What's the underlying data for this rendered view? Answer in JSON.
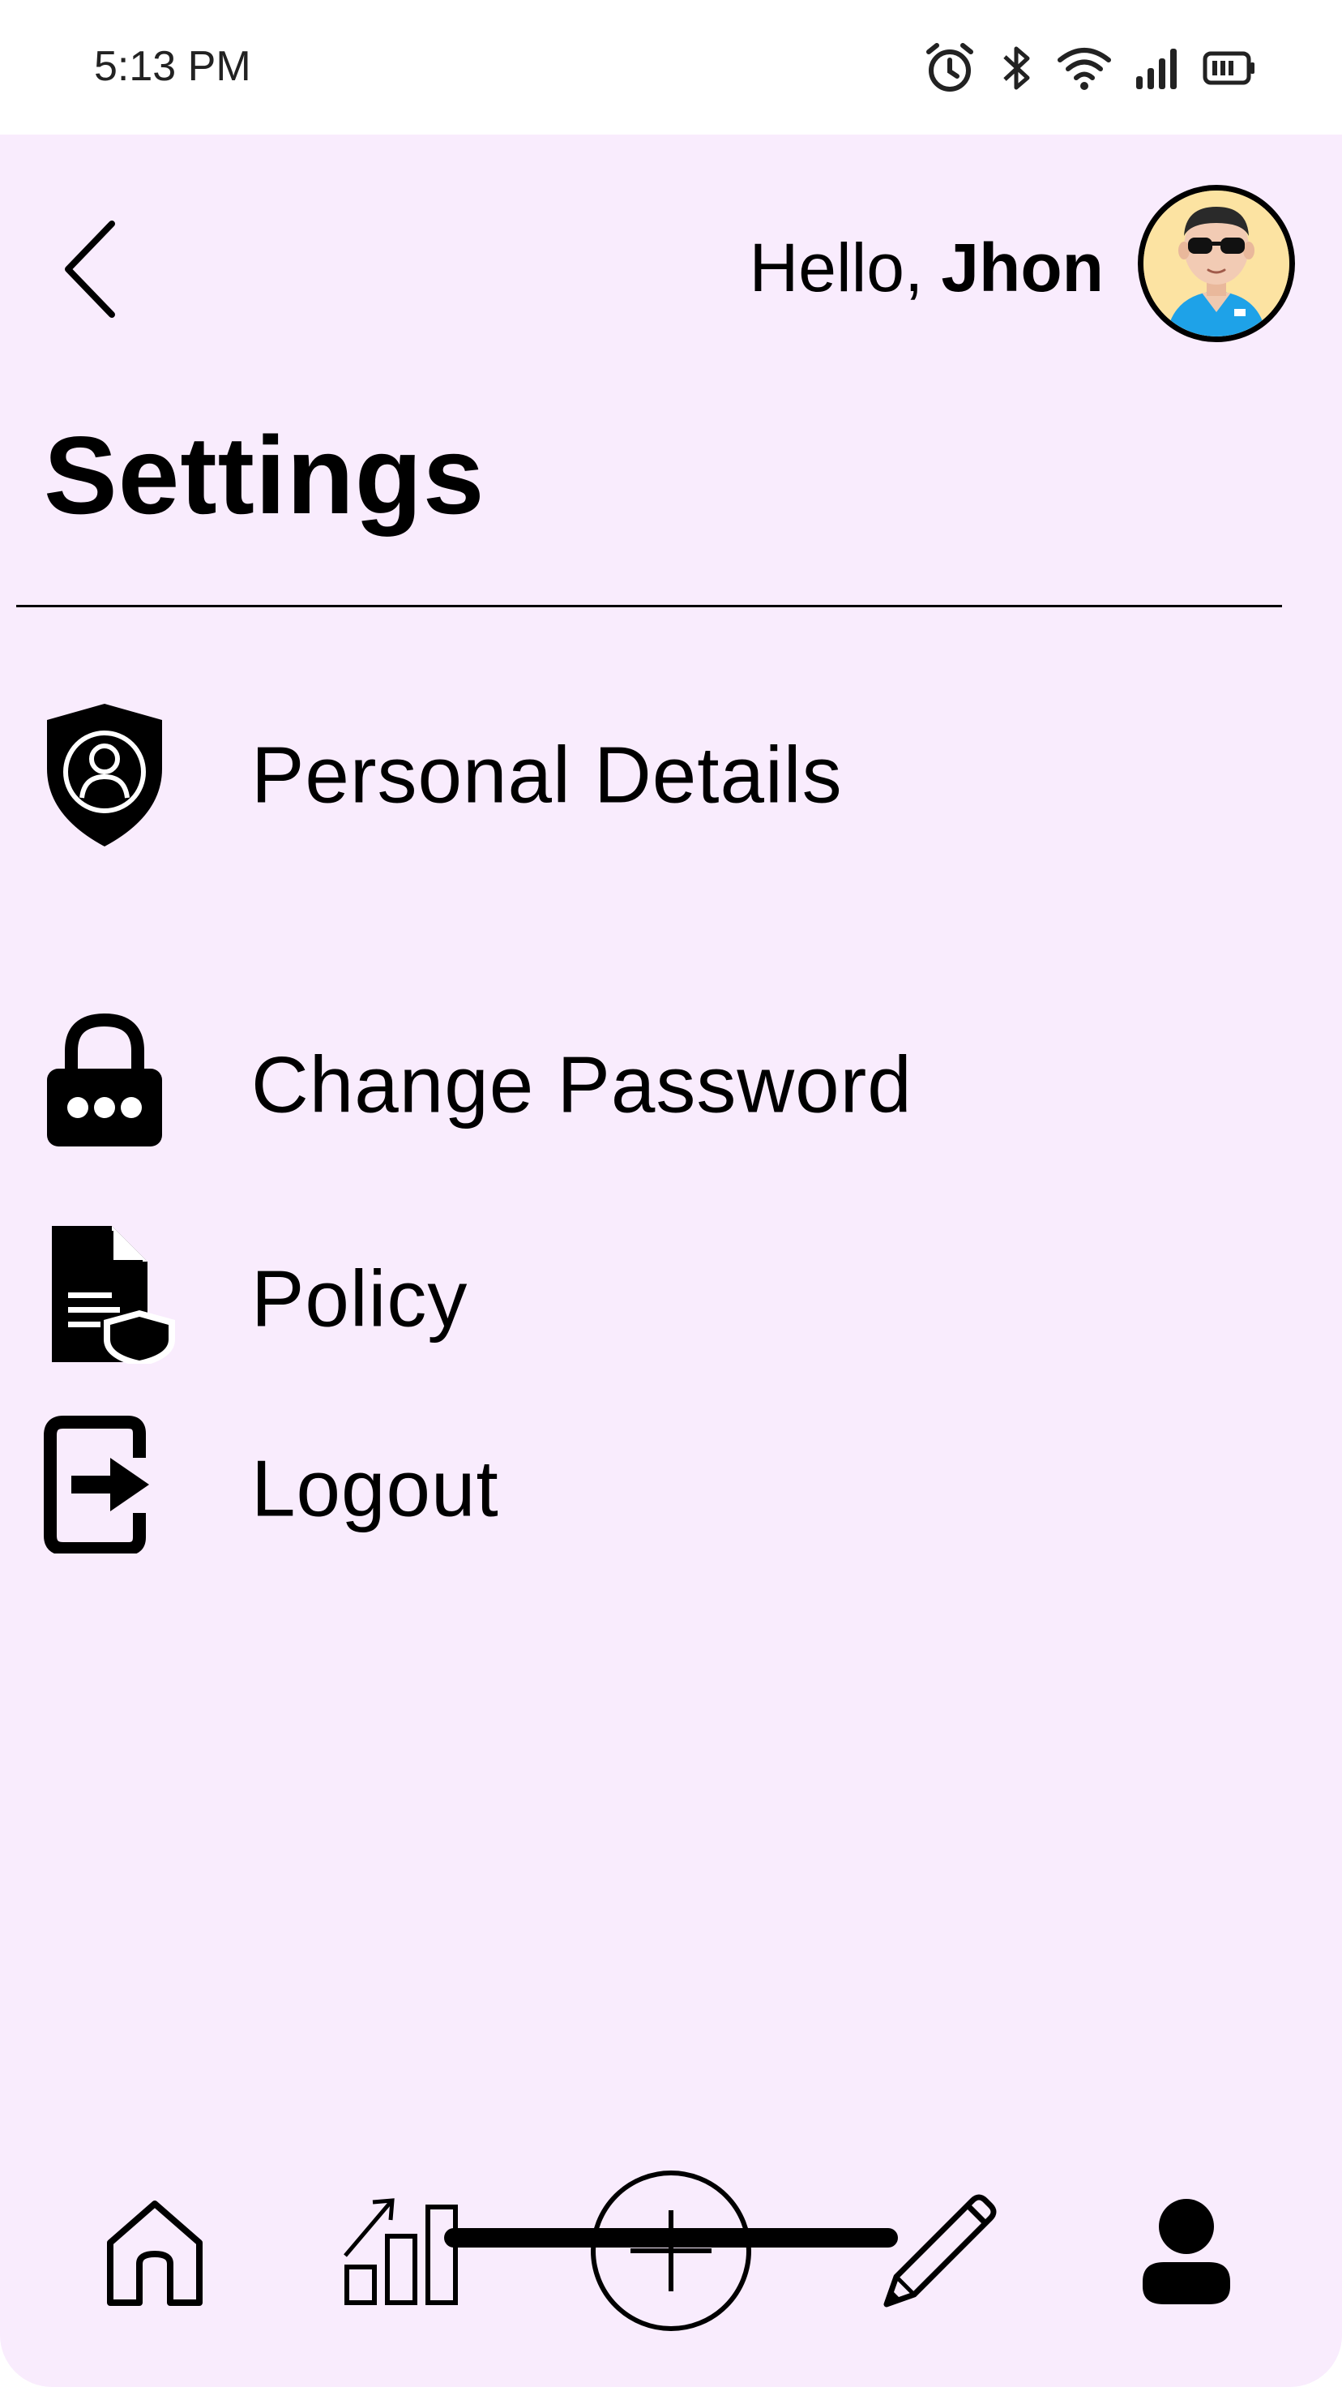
{
  "status_bar": {
    "time": "5:13 PM",
    "icons": [
      "alarm-icon",
      "bluetooth-icon",
      "wifi-icon",
      "signal-icon",
      "battery-icon"
    ]
  },
  "header": {
    "greeting": "Hello,",
    "user_name": "Jhon",
    "avatar_icon": "user-avatar"
  },
  "page": {
    "title": "Settings"
  },
  "menu": {
    "items": [
      {
        "label": "Personal Details",
        "icon": "shield-user-icon"
      },
      {
        "label": "Change Password",
        "icon": "lock-icon"
      },
      {
        "label": "Policy",
        "icon": "policy-document-icon"
      },
      {
        "label": "Logout",
        "icon": "logout-icon"
      }
    ]
  },
  "bottom_nav": {
    "items": [
      {
        "name": "home",
        "icon": "home-icon"
      },
      {
        "name": "stats",
        "icon": "chart-icon"
      },
      {
        "name": "add",
        "icon": "plus-circle-icon"
      },
      {
        "name": "edit",
        "icon": "pencil-icon"
      },
      {
        "name": "profile",
        "icon": "person-icon"
      }
    ]
  },
  "colors": {
    "app_background": "#f9ecfd",
    "status_bar_background": "#ffffff",
    "text": "#000000",
    "avatar_background": "#fce3a2"
  }
}
